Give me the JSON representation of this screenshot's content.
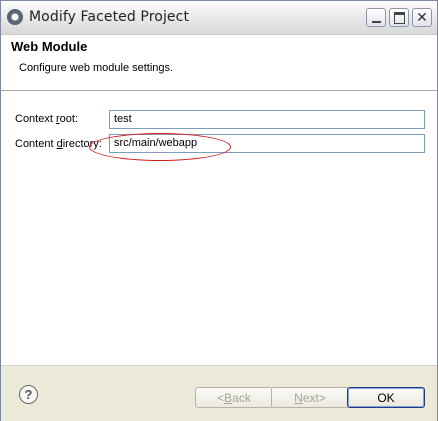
{
  "window": {
    "title": "Modify Faceted Project"
  },
  "header": {
    "title": "Web Module",
    "description": "Configure web module settings."
  },
  "form": {
    "context_root": {
      "label_pre": "Context ",
      "label_underlined": "r",
      "label_post": "oot:",
      "value": "test"
    },
    "content_directory": {
      "label_pre": "Content ",
      "label_underlined": "d",
      "label_post": "irectory:",
      "value": "src/main/webapp"
    }
  },
  "footer": {
    "help_symbol": "?",
    "back": {
      "arrow": "< ",
      "underlined": "B",
      "rest": "ack"
    },
    "next": {
      "underlined": "N",
      "rest": "ext",
      "arrow": " >"
    },
    "ok_label": "OK"
  },
  "icons": [
    "app-icon",
    "minimize-icon",
    "maximize-icon",
    "close-icon",
    "help-icon"
  ],
  "colors": {
    "annotation": "#d21c1c",
    "title_bar": "#e6e6e6",
    "dialog_bg": "#ece9d8"
  }
}
